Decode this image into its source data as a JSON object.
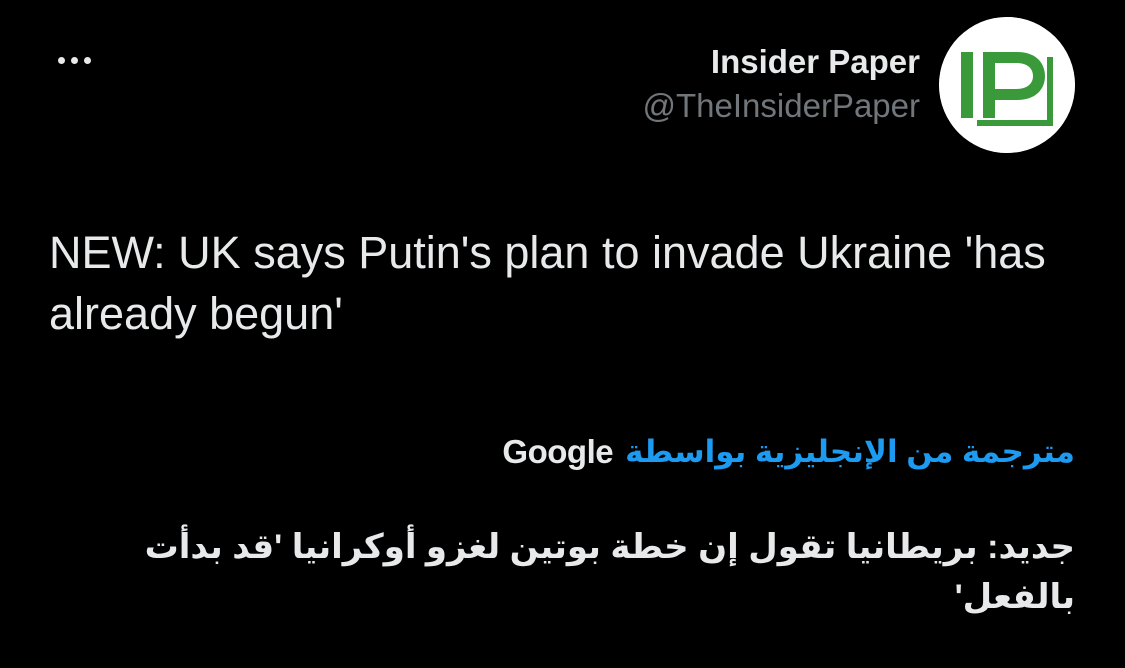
{
  "tweet": {
    "author": {
      "display_name": "Insider Paper",
      "handle": "@TheInsiderPaper",
      "avatar_logo": "IP",
      "avatar_logo_color": "#3a9a3a"
    },
    "more_icon": "more-horizontal-icon",
    "text": "NEW: UK says Putin's plan to invade Ukraine 'has already begun'",
    "translation": {
      "label": "مترجمة من الإنجليزية بواسطة",
      "provider": "Google",
      "link_color": "#1d9bf0",
      "text": "جديد: بريطانيا تقول إن خطة بوتين لغزو أوكرانيا 'قد بدأت بالفعل'"
    }
  },
  "colors": {
    "background": "#000000",
    "primary_text": "#e7e9ea",
    "secondary_text": "#71767b"
  }
}
